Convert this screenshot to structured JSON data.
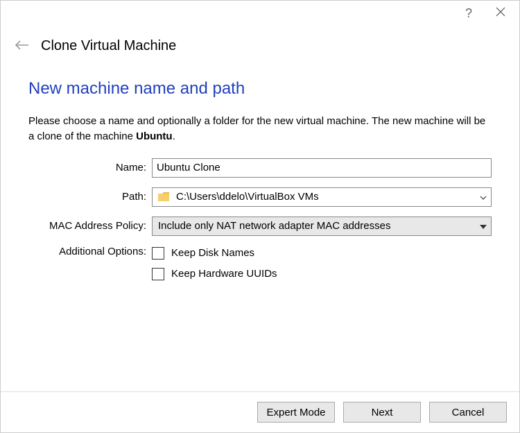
{
  "wizard": {
    "title": "Clone Virtual Machine"
  },
  "page": {
    "heading": "New machine name and path",
    "intro_prefix": "Please choose a name and optionally a folder for the new virtual machine. The new machine will be a clone of the machine ",
    "intro_machine": "Ubuntu",
    "intro_suffix": "."
  },
  "form": {
    "name_label": "Name:",
    "name_value": "Ubuntu Clone",
    "path_label": "Path:",
    "path_value": "C:\\Users\\ddelo\\VirtualBox VMs",
    "mac_label": "MAC Address Policy:",
    "mac_value": "Include only NAT network adapter MAC addresses",
    "options_label": "Additional Options:",
    "keep_disk_label": "Keep Disk Names",
    "keep_uuid_label": "Keep Hardware UUIDs"
  },
  "footer": {
    "expert": "Expert Mode",
    "next": "Next",
    "cancel": "Cancel"
  }
}
